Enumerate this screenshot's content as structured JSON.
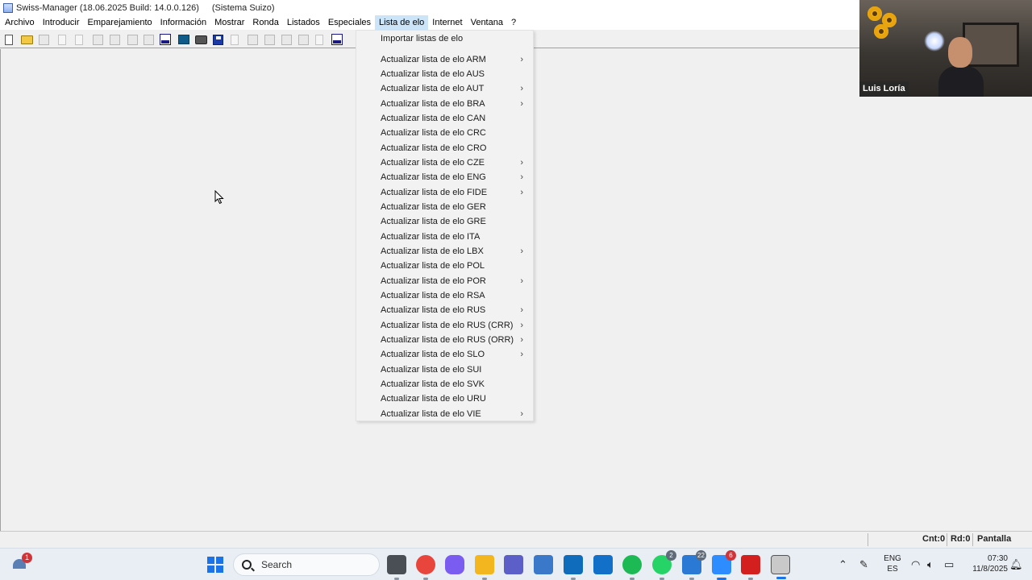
{
  "window": {
    "title": "Swiss-Manager (18.06.2025 Build: 14.0.0.126)",
    "subtitle": "(Sistema Suizo)"
  },
  "menubar": {
    "items": [
      "Archivo",
      "Introducir",
      "Emparejamiento",
      "Información",
      "Mostrar",
      "Ronda",
      "Listados",
      "Especiales",
      "Lista de elo",
      "Internet",
      "Ventana",
      "?"
    ],
    "open_menu": "Lista de elo"
  },
  "toolbar": {
    "icons": [
      "new-document-icon",
      "open-folder-icon",
      "save-icon",
      "document-icon",
      "pairing-icon",
      "sp-icon",
      "pairing-list-icon",
      "score-icon",
      "tournament-icon",
      "round-icon",
      "elo-icon",
      "screen-icon",
      "print-icon",
      "save-disk-icon",
      "sp-doc-icon",
      "abc-sort-icon",
      "elo-sort-icon",
      "number-sort-icon",
      "equal-sort-icon",
      "ratio-icon",
      "opt-icon"
    ]
  },
  "dropdown": {
    "header": "Importar listas de elo",
    "items": [
      {
        "label": "Actualizar lista de elo ARM",
        "submenu": true
      },
      {
        "label": "Actualizar lista de elo AUS",
        "submenu": false
      },
      {
        "label": "Actualizar lista de elo AUT",
        "submenu": true
      },
      {
        "label": "Actualizar lista de elo BRA",
        "submenu": true
      },
      {
        "label": "Actualizar lista de elo CAN",
        "submenu": false
      },
      {
        "label": "Actualizar lista de elo CRC",
        "submenu": false
      },
      {
        "label": "Actualizar lista de elo CRO",
        "submenu": false
      },
      {
        "label": "Actualizar lista de elo CZE",
        "submenu": true
      },
      {
        "label": "Actualizar lista de elo ENG",
        "submenu": true
      },
      {
        "label": "Actualizar lista de elo FIDE",
        "submenu": true
      },
      {
        "label": "Actualizar lista de elo GER",
        "submenu": false
      },
      {
        "label": "Actualizar lista de elo GRE",
        "submenu": false
      },
      {
        "label": "Actualizar lista de elo ITA",
        "submenu": false
      },
      {
        "label": "Actualizar lista de elo LBX",
        "submenu": true
      },
      {
        "label": "Actualizar lista de elo POL",
        "submenu": false
      },
      {
        "label": "Actualizar lista de elo POR",
        "submenu": true
      },
      {
        "label": "Actualizar lista de elo RSA",
        "submenu": false
      },
      {
        "label": "Actualizar lista de elo RUS",
        "submenu": true
      },
      {
        "label": "Actualizar lista de elo RUS (CRR)",
        "submenu": true
      },
      {
        "label": "Actualizar lista de elo RUS (ORR)",
        "submenu": true
      },
      {
        "label": "Actualizar lista de elo SLO",
        "submenu": true
      },
      {
        "label": "Actualizar lista de elo SUI",
        "submenu": false
      },
      {
        "label": "Actualizar lista de elo SVK",
        "submenu": false
      },
      {
        "label": "Actualizar lista de elo URU",
        "submenu": false
      },
      {
        "label": "Actualizar lista de elo VIE",
        "submenu": true
      }
    ],
    "arrow_glyph": "›"
  },
  "statusbar": {
    "cnt": "Cnt:0",
    "rd": "Rd:0",
    "mode": "Pantalla"
  },
  "video": {
    "participant_name": "Luis Loría"
  },
  "taskbar": {
    "weather_badge": "1",
    "search_placeholder": "Search",
    "apps": [
      {
        "name": "task-view-app",
        "color": "#4a4f55",
        "badge": ""
      },
      {
        "name": "chrome-app",
        "color": "#e8453c",
        "badge": ""
      },
      {
        "name": "copilot-app",
        "color": "#7b5cf0",
        "badge": ""
      },
      {
        "name": "file-explorer-app",
        "color": "#f3b61f",
        "badge": ""
      },
      {
        "name": "teams-app",
        "color": "#5b5fc7",
        "badge": ""
      },
      {
        "name": "calculator-app",
        "color": "#3a78c9",
        "badge": ""
      },
      {
        "name": "outlook-app",
        "color": "#0f6cbd",
        "badge": ""
      },
      {
        "name": "outlook-new-app",
        "color": "#1370c8",
        "badge": ""
      },
      {
        "name": "spotify-app",
        "color": "#1db954",
        "badge": ""
      },
      {
        "name": "whatsapp-app",
        "color": "#25d366",
        "badge": "2"
      },
      {
        "name": "messages-app",
        "color": "#2a7ad5",
        "badge": "22"
      },
      {
        "name": "zoom-app",
        "color": "#2d8cff",
        "badge": "6"
      },
      {
        "name": "acrobat-app",
        "color": "#d41f1f",
        "badge": ""
      },
      {
        "name": "swiss-manager-app",
        "color": "#c9c9c9",
        "badge": ""
      }
    ],
    "lang_top": "ENG",
    "lang_bottom": "ES",
    "time": "07:30",
    "date": "11/8/2025"
  }
}
